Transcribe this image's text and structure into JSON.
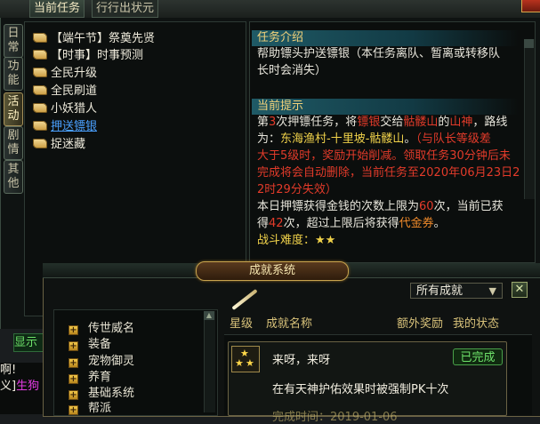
{
  "top_tabs": [
    "当前任务",
    "行行出状元"
  ],
  "side_tabs": [
    "日常",
    "功能",
    "活动",
    "剧情",
    "其他"
  ],
  "active_side_tab": 2,
  "quests": [
    {
      "label": "【端午节】祭奠先贤"
    },
    {
      "label": "【时事】时事预测"
    },
    {
      "label": "全民升级"
    },
    {
      "label": "全民刷道"
    },
    {
      "label": "小妖猎人"
    },
    {
      "label": "押送镖银"
    },
    {
      "label": "捉迷藏"
    }
  ],
  "selected_quest": 5,
  "intro": {
    "heading": "任务介绍",
    "line1": "帮助镖头护送镖银（本任务离队、暂离或转移队",
    "line2": "长时会消失）"
  },
  "hint": {
    "heading": "当前提示",
    "p1_a": "第",
    "p1_num": "3",
    "p1_b": "次押镖任务，将",
    "p1_item": "镖银",
    "p1_c": "交给",
    "p1_place": "骷髅山",
    "p1_d": "的",
    "p1_npc": "山神",
    "p1_e": "，路线",
    "route_label": "为：",
    "route": "东海渔村-十里坡-骷髅山",
    "route_end": "。",
    "warn1": "（与队长等级差",
    "warn2": "大于5级时，奖励开始削减。领取任务30分钟后未",
    "warn3": "完成将会自动删除，当前任务至2020年06月23日2",
    "warn4": "2时29分失效）",
    "daily_a": "本日押镖获得金钱的次数上限为",
    "daily_limit": "60",
    "daily_b": "次，当前已获",
    "daily_c": "得",
    "daily_done": "42",
    "daily_d": "次，超过上限后将获得",
    "daily_reward": "代金券",
    "daily_e": "。",
    "difficulty_label": "战斗难度：",
    "difficulty_stars": "★★"
  },
  "achievement": {
    "title": "成就系统",
    "filter_value": "所有成就",
    "close_glyph": "✕",
    "categories": [
      "传世威名",
      "装备",
      "宠物御灵",
      "养育",
      "基础系统",
      "帮派"
    ],
    "header": {
      "stars": "星级",
      "name": "成就名称",
      "extra": "额外奖励",
      "status": "我的状态"
    },
    "entry": {
      "name": "来呀，来呀",
      "status": "已完成",
      "desc": "在有天神护佑效果时被强制PK十次",
      "faded": "完成时间：2019-01-06"
    }
  },
  "fragments": {
    "display_btn": "显示",
    "chat_line1": "啊!",
    "chat_line2_a": "义]",
    "chat_line2_b": "生狗"
  },
  "colors": {
    "accent_red": "#e23b2a",
    "link_blue": "#4aa0ff",
    "status_green": "#6ee26a",
    "gold": "#f2d27a"
  }
}
